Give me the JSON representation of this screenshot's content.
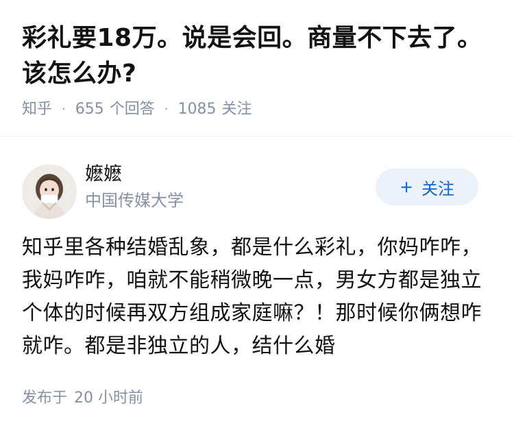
{
  "question": {
    "title": "彩礼要18万。说是会回。商量不下去了。该怎么办?",
    "source": "知乎",
    "answer_count": "655",
    "answer_label": "个回答",
    "follower_count": "1085",
    "follower_label": "关注"
  },
  "answer": {
    "author": {
      "name": "嬷嬷",
      "description": "中国传媒大学",
      "avatar_icon": "girl-avatar"
    },
    "follow_label": "关注",
    "content": "知乎里各种结婚乱象，都是什么彩礼，你妈咋咋，我妈咋咋，咱就不能稍微晚一点，男女方都是独立个体的时候再双方组成家庭嘛？！那时候你俩想咋就咋。都是非独立的人，结什么婚",
    "published_label": "发布于",
    "published_time": "20 小时前"
  },
  "colors": {
    "meta_gray": "#8590a6",
    "follow_bg": "#ebf2fa",
    "follow_text": "#0a66d8"
  }
}
